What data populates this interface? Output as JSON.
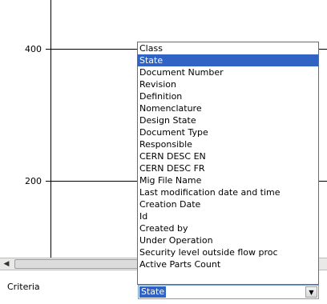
{
  "chart": {
    "y_ticks": [
      "400",
      "200"
    ]
  },
  "criteria": {
    "label": "Criteria",
    "selected_value": "State"
  },
  "dropdown": {
    "selected_index": 1,
    "options": [
      "Class",
      "State",
      "Document Number",
      "Revision",
      "Definition",
      "Nomenclature",
      "Design State",
      "Document Type",
      "Responsible",
      "CERN DESC EN",
      "CERN DESC FR",
      "Mig File Name",
      "Last modification date and time",
      "Creation Date",
      "Id",
      "Created by",
      "Under Operation",
      "Security level outside flow proc",
      "Active Parts Count"
    ]
  },
  "icons": {
    "scroll_left": "chevron-left-icon",
    "dropdown_arrow": "chevron-down-icon"
  }
}
